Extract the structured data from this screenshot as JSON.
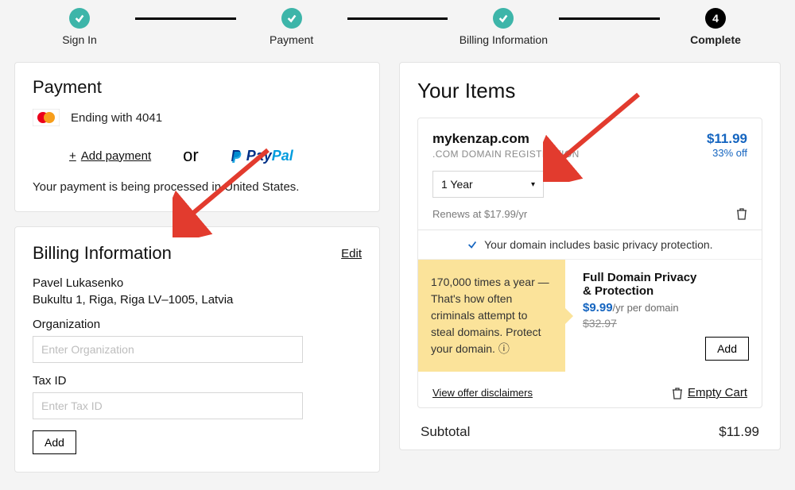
{
  "steps": {
    "s1": {
      "label": "Sign In"
    },
    "s2": {
      "label": "Payment"
    },
    "s3": {
      "label": "Billing Information"
    },
    "s4": {
      "label": "Complete",
      "number": "4"
    }
  },
  "payment": {
    "title": "Payment",
    "card_ending": "Ending with 4041",
    "add_payment": "Add payment",
    "or": "or",
    "paypal_pay": "Pay",
    "paypal_pal": "Pal",
    "processed_in": "Your payment is being processed in United States."
  },
  "billing": {
    "title": "Billing Information",
    "edit": "Edit",
    "name": "Pavel Lukasenko",
    "address": "Bukultu 1, Riga, Riga LV–1005, Latvia",
    "org_label": "Organization",
    "org_placeholder": "Enter Organization",
    "tax_label": "Tax ID",
    "tax_placeholder": "Enter Tax ID",
    "add_btn": "Add"
  },
  "items": {
    "title": "Your Items",
    "domain": {
      "name": "mykenzap.com",
      "desc": ".COM Domain Registration",
      "price": "$11.99",
      "discount": "33% off",
      "term_selected": "1 Year",
      "renews": "Renews at $17.99/yr"
    },
    "privacy_note": "Your domain includes basic privacy protection.",
    "promo": {
      "pitch": "170,000 times a year — That's how often criminals attempt to steal domains. Protect your domain. ⓘ",
      "title": "Full Domain Privacy & Protection",
      "price": "$9.99",
      "period": "/yr per domain",
      "strike": "$32.97",
      "add": "Add"
    },
    "disclaimer": "View offer disclaimers",
    "empty_cart": "Empty Cart",
    "subtotal_label": "Subtotal",
    "subtotal_value": "$11.99"
  }
}
